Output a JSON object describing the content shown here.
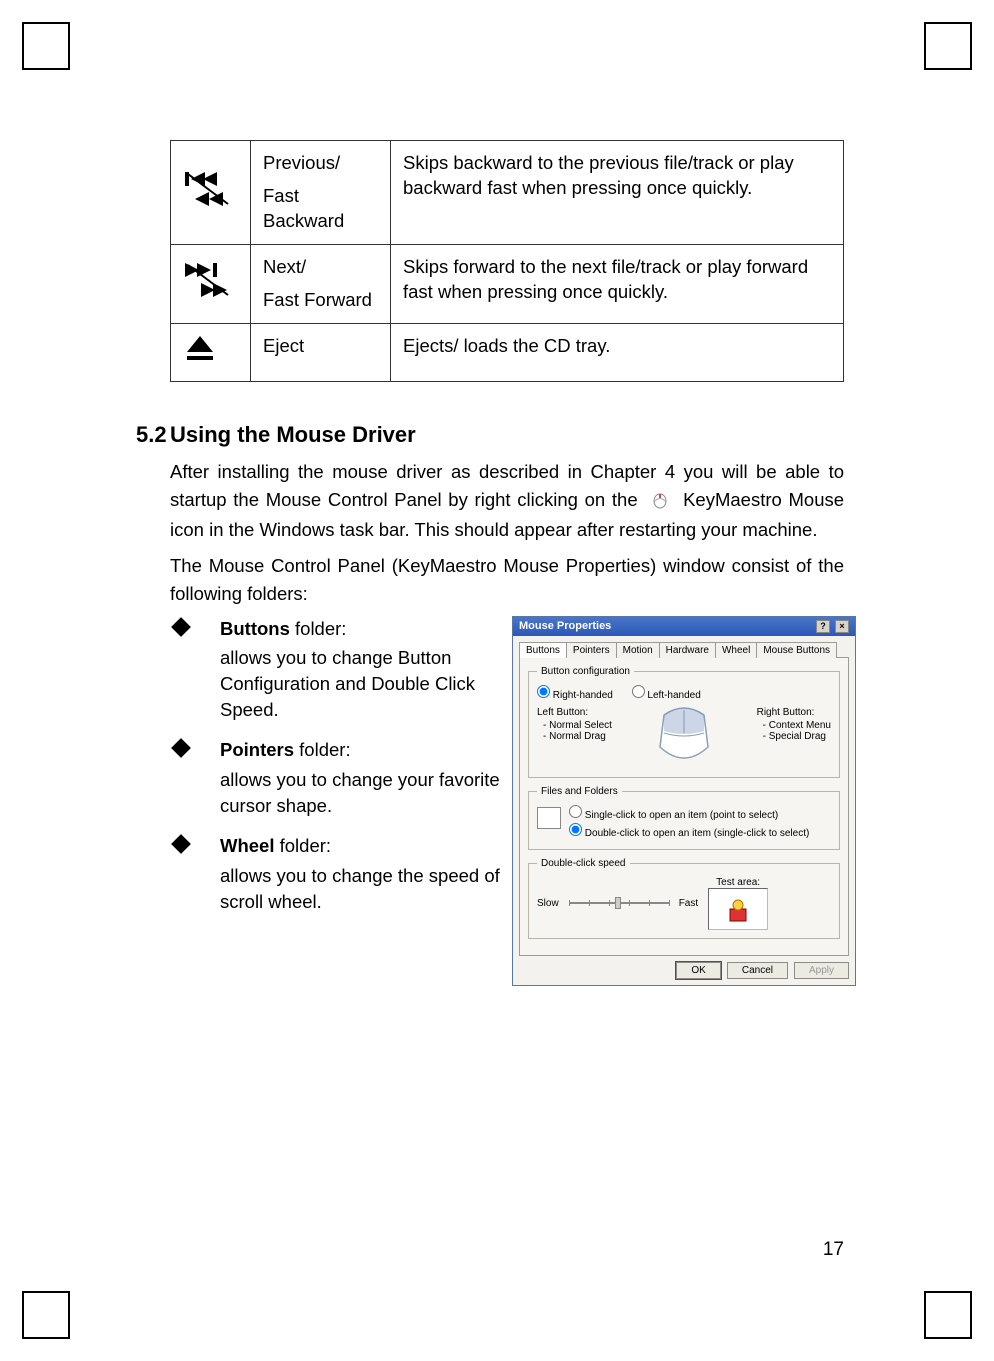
{
  "table_rows": [
    {
      "name_a": "Previous/",
      "name_b": "Fast Backward",
      "desc": "Skips backward to the previous file/track or play backward fast when pressing once quickly."
    },
    {
      "name_a": "Next/",
      "name_b": "Fast Forward",
      "desc": "Skips forward to the next file/track or play forward fast when pressing once quickly."
    },
    {
      "name_a": "Eject",
      "name_b": "",
      "desc": "Ejects/ loads the CD tray."
    }
  ],
  "section": {
    "num": "5.2",
    "title": "Using the Mouse Driver"
  },
  "para1a": "After installing the mouse driver as described in Chapter 4 you will be able to startup the Mouse Control Panel by right clicking on the",
  "para1b": "KeyMaestro Mouse icon   in the Windows task bar. This should appear after restarting your machine.",
  "para2": "The Mouse Control Panel (KeyMaestro Mouse Properties) window consist of the following folders:",
  "bullets": [
    {
      "title": "Buttons",
      "tail": " folder:",
      "desc": "allows you to change Button Configuration and Double Click Speed."
    },
    {
      "title": "Pointers",
      "tail": " folder:",
      "desc": "allows you to change your favorite cursor shape."
    },
    {
      "title": "Wheel",
      "tail": " folder:",
      "desc": "allows you to change the speed of scroll wheel."
    }
  ],
  "dialog": {
    "title": "Mouse Properties",
    "tabs": [
      "Buttons",
      "Pointers",
      "Motion",
      "Hardware",
      "Wheel",
      "Mouse Buttons"
    ],
    "grp_button": "Button configuration",
    "radio_right": "Right-handed",
    "radio_left": "Left-handed",
    "left_label": "Left Button:",
    "left_items": [
      "Normal Select",
      "Normal Drag"
    ],
    "right_label": "Right Button:",
    "right_items": [
      "Context Menu",
      "Special Drag"
    ],
    "grp_files": "Files and Folders",
    "files_single": "Single-click to open an item (point to select)",
    "files_double": "Double-click to open an item (single-click to select)",
    "grp_speed": "Double-click speed",
    "slow": "Slow",
    "fast": "Fast",
    "test": "Test area:",
    "ok": "OK",
    "cancel": "Cancel",
    "apply": "Apply"
  },
  "page_number": "17"
}
